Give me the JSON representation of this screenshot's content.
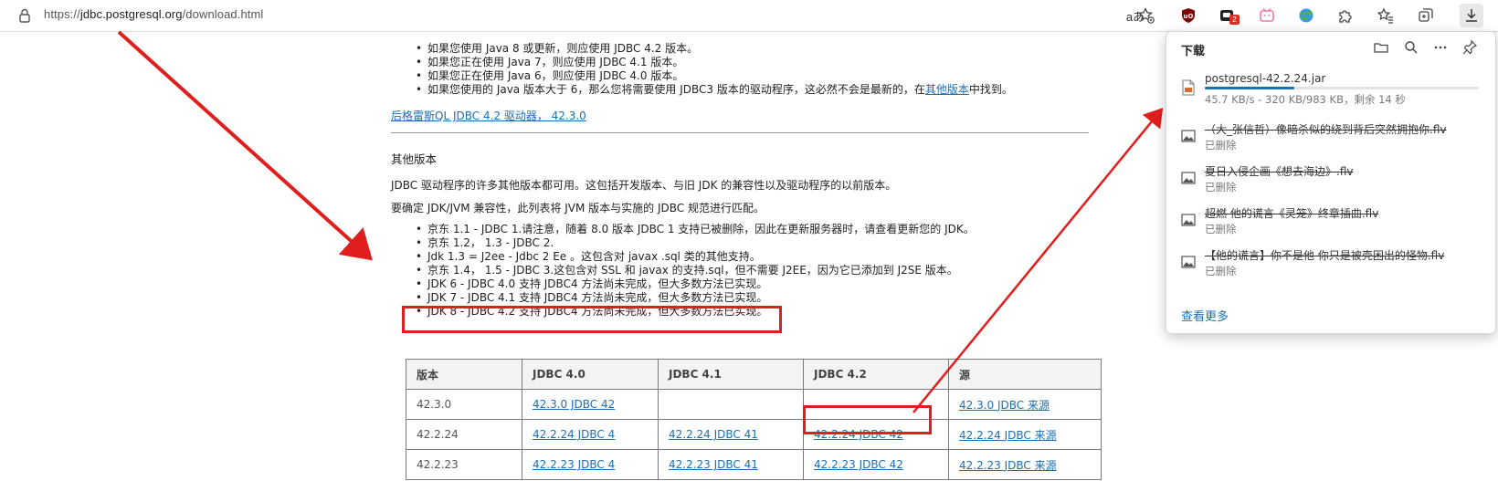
{
  "browser": {
    "url_scheme": "https://",
    "url_domain": "jdbc.postgresql.org",
    "url_path": "/download.html",
    "read_aloud_label": "aあ",
    "extension_badge": "2"
  },
  "page": {
    "top_bullets": [
      "如果您使用 Java 8 或更新，则应使用 JDBC 4.2 版本。",
      "如果您正在使用 Java 7，则应使用 JDBC 4.1 版本。",
      "如果您正在使用 Java 6，则应使用 JDBC 4.0 版本。"
    ],
    "bullet4_pre": "如果您使用的 Java 版本大于 6，那么您将需要使用 JDBC3 版本的驱动程序，这必然不会是最新的，在",
    "bullet4_link": "其他版本",
    "bullet4_post": "中找到。",
    "driver_link": "后格雷斯QL JDBC 4.2 驱动器， 42.3.0",
    "other_heading": "其他版本",
    "para1": "JDBC 驱动程序的许多其他版本都可用。这包括开发版本、与旧 JDK 的兼容性以及驱动程序的以前版本。",
    "para2": "要确定 JDK/JVM 兼容性，此列表将 JVM 版本与实施的 JDBC 规范进行匹配。",
    "jdk_list": [
      "京东 1.1 - JDBC 1.请注意，随着 8.0 版本 JDBC 1 支持已被删除，因此在更新服务器时，请查看更新您的 JDK。",
      "京东 1.2，  1.3 - JDBC 2.",
      "Jdk 1.3 = J2ee - Jdbc 2 Ee 。这包含对 javax .sql 类的其他支持。",
      "京东 1.4，  1.5 - JDBC 3.这包含对 SSL 和 javax 的支持.sql，但不需要 J2EE，因为它已添加到 J2SE 版本。",
      "JDK 6 - JDBC 4.0 支持 JDBC4 方法尚未完成，但大多数方法已实现。",
      "JDK 7 - JDBC 4.1 支持 JDBC4 方法尚未完成，但大多数方法已实现。",
      "JDK 8 - JDBC 4.2 支持 JDBC4 方法尚未完成，但大多数方法已实现。"
    ],
    "table": {
      "headers": [
        "版本",
        "JDBC 4.0",
        "JDBC 4.1",
        "JDBC 4.2",
        "源"
      ],
      "rows": [
        [
          "42.3.0",
          "42.3.0 JDBC 42",
          "",
          "",
          "42.3.0 JDBC 来源"
        ],
        [
          "42.2.24",
          "42.2.24 JDBC 4",
          "42.2.24 JDBC 41",
          "42.2.24 JDBC 42",
          "42.2.24 JDBC 来源"
        ],
        [
          "42.2.23",
          "42.2.23 JDBC 4",
          "42.2.23 JDBC 41",
          "42.2.23 JDBC 42",
          "42.2.23 JDBC 来源"
        ]
      ]
    }
  },
  "downloads": {
    "title": "下载",
    "active": {
      "name": "postgresql-42.2.24.jar",
      "status": "45.7 KB/s - 320 KB/983 KB，剩余 14 秒",
      "progress": 0.325
    },
    "items": [
      {
        "name": "（大_张信哲）像暗杀似的绕到背后突然拥抱你.flv",
        "status": "已删除"
      },
      {
        "name": "夏日入侵企画《想去海边》.flv",
        "status": "已删除"
      },
      {
        "name": "超燃 他的谎言《灵笼》终章插曲.flv",
        "status": "已删除"
      },
      {
        "name": "【他的谎言】你不是他 你只是被壳困出的怪物.flv",
        "status": "已删除"
      }
    ],
    "see_more": "查看更多"
  },
  "colors": {
    "link": "#1a6fb5",
    "annotation_red": "#e01e1e"
  }
}
